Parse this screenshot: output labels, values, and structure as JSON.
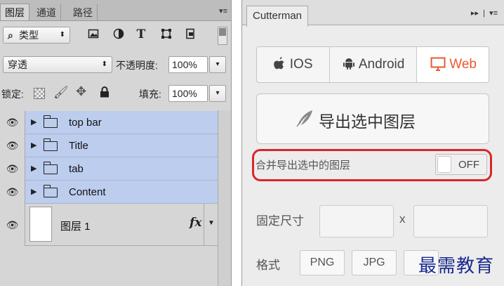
{
  "layers_panel": {
    "tabs": [
      "图层",
      "通道",
      "路径"
    ],
    "filter_kind": "类型",
    "blend_mode": "穿透",
    "opacity_label": "不透明度:",
    "opacity_value": "100%",
    "lock_label": "锁定:",
    "fill_label": "填充:",
    "fill_value": "100%",
    "filter_icons": [
      "image-filter-icon",
      "adjustment-filter-icon",
      "type-filter-icon",
      "shape-filter-icon",
      "smart-object-filter-icon"
    ],
    "layers": [
      {
        "name": "top bar",
        "type": "group",
        "selected": true
      },
      {
        "name": "Title",
        "type": "group",
        "selected": true
      },
      {
        "name": "tab",
        "type": "group",
        "selected": true
      },
      {
        "name": "Content",
        "type": "group",
        "selected": true
      },
      {
        "name": "图层 1",
        "type": "layer",
        "selected": false
      }
    ],
    "fx_label": "fx"
  },
  "cutterman": {
    "title": "Cutterman",
    "platforms": [
      {
        "label": "IOS",
        "icon": "apple-icon",
        "active": false
      },
      {
        "label": "Android",
        "icon": "android-icon",
        "active": false
      },
      {
        "label": "Web",
        "icon": "monitor-icon",
        "active": true
      }
    ],
    "export_label": "导出选中图层",
    "merge_label": "合并导出选中的图层",
    "merge_state": "OFF",
    "fixed_size_label": "固定尺寸",
    "size_separator": "x",
    "format_label": "格式",
    "formats": [
      "PNG",
      "JPG"
    ],
    "accent_color": "#e8592f",
    "highlight_color": "#d8262b"
  },
  "watermark": "最需教育"
}
